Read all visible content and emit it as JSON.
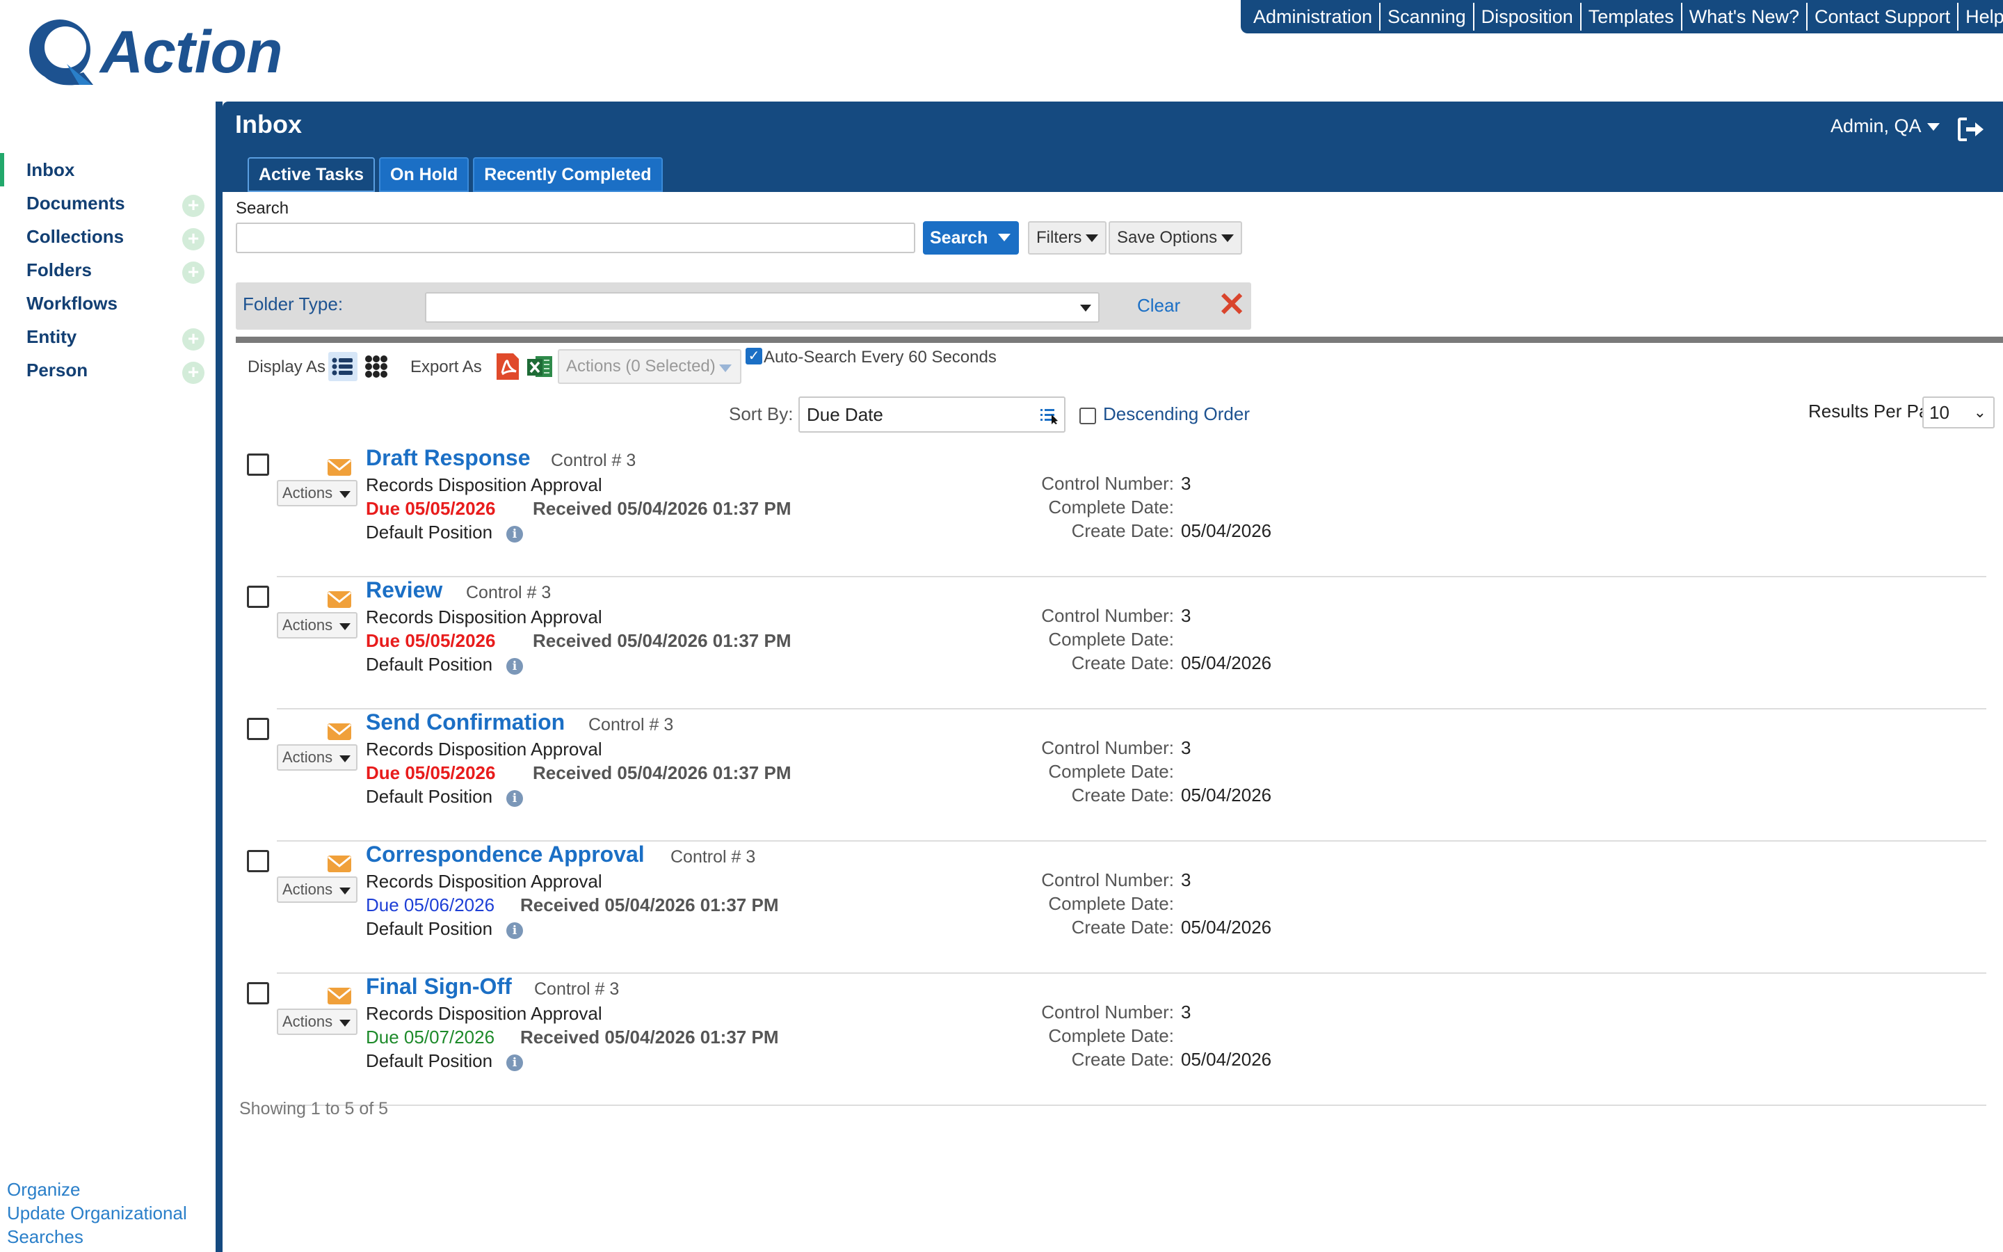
{
  "topnav": [
    "Administration",
    "Scanning",
    "Disposition",
    "Templates",
    "What's New?",
    "Contact Support",
    "Help"
  ],
  "logo_text": "Action",
  "sidebar": {
    "items": [
      {
        "label": "Inbox",
        "has_add": false,
        "active": true
      },
      {
        "label": "Documents",
        "has_add": true
      },
      {
        "label": "Collections",
        "has_add": true
      },
      {
        "label": "Folders",
        "has_add": true
      },
      {
        "label": "Workflows",
        "has_add": false
      },
      {
        "label": "Entity",
        "has_add": true
      },
      {
        "label": "Person",
        "has_add": true
      }
    ],
    "bottom_links": [
      "Organize",
      "Update Organizational",
      "Searches"
    ]
  },
  "header": {
    "title": "Inbox",
    "user": "Admin, QA"
  },
  "tabs": [
    "Active Tasks",
    "On Hold",
    "Recently Completed"
  ],
  "search": {
    "label": "Search",
    "value": "",
    "button": "Search",
    "filters": "Filters",
    "save_options": "Save Options"
  },
  "folder_type": {
    "label": "Folder Type:",
    "value": "",
    "clear": "Clear"
  },
  "toolbar": {
    "display_as": "Display As",
    "export_as": "Export As",
    "actions": "Actions (0 Selected)",
    "auto_search": "Auto-Search Every 60 Seconds",
    "auto_search_checked": true
  },
  "sort": {
    "label": "Sort By:",
    "value": "Due Date",
    "descending": "Descending Order",
    "results_label": "Results Per Page:",
    "results_value": "10"
  },
  "tasks": [
    {
      "title": "Draft Response",
      "control": "Control # 3",
      "subtitle": "Records Disposition Approval",
      "due": "Due 05/05/2026",
      "due_status": "overdue",
      "received": "Received 05/04/2026 01:37 PM",
      "position": "Default Position",
      "actions": "Actions",
      "control_number_label": "Control Number:",
      "control_number": "3",
      "complete_date_label": "Complete Date:",
      "complete_date": "",
      "create_date_label": "Create Date:",
      "create_date": "05/04/2026"
    },
    {
      "title": "Review",
      "control": "Control # 3",
      "subtitle": "Records Disposition Approval",
      "due": "Due 05/05/2026",
      "due_status": "overdue",
      "received": "Received 05/04/2026 01:37 PM",
      "position": "Default Position",
      "actions": "Actions",
      "control_number_label": "Control Number:",
      "control_number": "3",
      "complete_date_label": "Complete Date:",
      "complete_date": "",
      "create_date_label": "Create Date:",
      "create_date": "05/04/2026"
    },
    {
      "title": "Send Confirmation",
      "control": "Control # 3",
      "subtitle": "Records Disposition Approval",
      "due": "Due 05/05/2026",
      "due_status": "overdue",
      "received": "Received 05/04/2026 01:37 PM",
      "position": "Default Position",
      "actions": "Actions",
      "control_number_label": "Control Number:",
      "control_number": "3",
      "complete_date_label": "Complete Date:",
      "complete_date": "",
      "create_date_label": "Create Date:",
      "create_date": "05/04/2026"
    },
    {
      "title": "Correspondence Approval",
      "control": "Control # 3",
      "subtitle": "Records Disposition Approval",
      "due": "Due 05/06/2026",
      "due_status": "today",
      "received": "Received 05/04/2026 01:37 PM",
      "position": "Default Position",
      "actions": "Actions",
      "control_number_label": "Control Number:",
      "control_number": "3",
      "complete_date_label": "Complete Date:",
      "complete_date": "",
      "create_date_label": "Create Date:",
      "create_date": "05/04/2026"
    },
    {
      "title": "Final Sign-Off",
      "control": "Control # 3",
      "subtitle": "Records Disposition Approval",
      "due": "Due 05/07/2026",
      "due_status": "upcoming",
      "received": "Received 05/04/2026 01:37 PM",
      "position": "Default Position",
      "actions": "Actions",
      "control_number_label": "Control Number:",
      "control_number": "3",
      "complete_date_label": "Complete Date:",
      "complete_date": "",
      "create_date_label": "Create Date:",
      "create_date": "05/04/2026"
    }
  ],
  "footer": {
    "showing": "Showing 1 to 5 of 5"
  },
  "colors": {
    "primary": "#154a80",
    "accent": "#1b6fc5",
    "overdue": "#e81c1c",
    "today": "#1e3fd6",
    "upcoming": "#1d8a2a",
    "active_marker": "#22a86b"
  }
}
